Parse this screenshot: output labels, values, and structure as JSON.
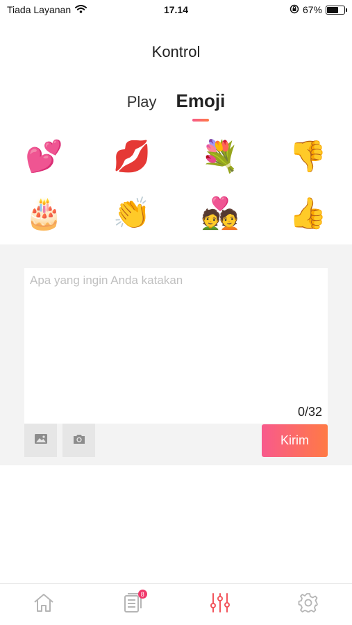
{
  "status_bar": {
    "carrier": "Tiada Layanan",
    "time": "17.14",
    "battery_percent": "67%",
    "battery_level": 0.67
  },
  "header": {
    "title": "Kontrol"
  },
  "tabs": [
    {
      "label": "Play",
      "active": false
    },
    {
      "label": "Emoji",
      "active": true
    }
  ],
  "emojis": [
    {
      "name": "hearts-emoji",
      "glyph": "💕"
    },
    {
      "name": "kiss-lips-emoji",
      "glyph": "💋"
    },
    {
      "name": "bouquet-emoji",
      "glyph": "💐"
    },
    {
      "name": "thumbs-down-emoji",
      "glyph": "👎"
    },
    {
      "name": "birthday-cake-emoji",
      "glyph": "🎂"
    },
    {
      "name": "clapping-hands-emoji",
      "glyph": "👏"
    },
    {
      "name": "couple-with-heart-emoji",
      "glyph": "💑"
    },
    {
      "name": "thumbs-up-emoji",
      "glyph": "👍"
    }
  ],
  "composer": {
    "placeholder": "Apa yang ingin Anda katakan",
    "value": "",
    "char_count": "0/32",
    "image_icon": "image-icon",
    "camera_icon": "camera-icon",
    "send_label": "Kirim"
  },
  "bottom_nav": {
    "items": [
      {
        "icon": "home-icon",
        "active": false
      },
      {
        "icon": "playlist-icon",
        "active": false,
        "badge": "8"
      },
      {
        "icon": "sliders-icon",
        "active": true
      },
      {
        "icon": "gear-icon",
        "active": false
      }
    ]
  },
  "colors": {
    "accent_start": "#f85a8c",
    "accent_end": "#ff7a45",
    "badge": "#f0386b",
    "inactive_icon": "#b5b5b5"
  }
}
